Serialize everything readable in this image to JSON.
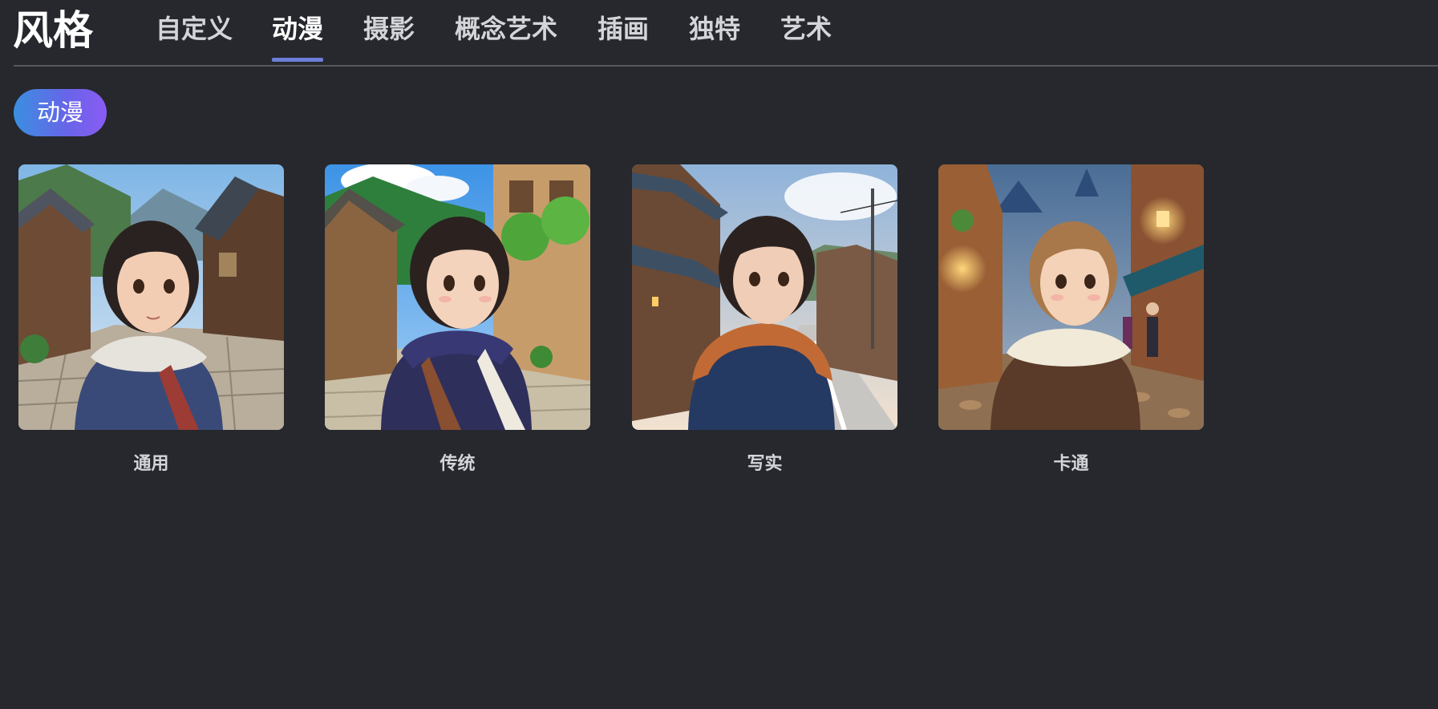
{
  "header": {
    "title": "风格",
    "tabs": [
      {
        "label": "自定义"
      },
      {
        "label": "动漫"
      },
      {
        "label": "摄影"
      },
      {
        "label": "概念艺术"
      },
      {
        "label": "插画"
      },
      {
        "label": "独特"
      },
      {
        "label": "艺术"
      }
    ],
    "active_tab": "动漫",
    "active_color": "#6c7fd8"
  },
  "filter": {
    "pill_label": "动漫"
  },
  "styles": [
    {
      "label": "通用",
      "scene": "daytime-village-street-girl"
    },
    {
      "label": "传统",
      "scene": "daytime-village-street-girl"
    },
    {
      "label": "写实",
      "scene": "daytime-street-girl"
    },
    {
      "label": "卡通",
      "scene": "evening-lantern-street-girl"
    }
  ]
}
